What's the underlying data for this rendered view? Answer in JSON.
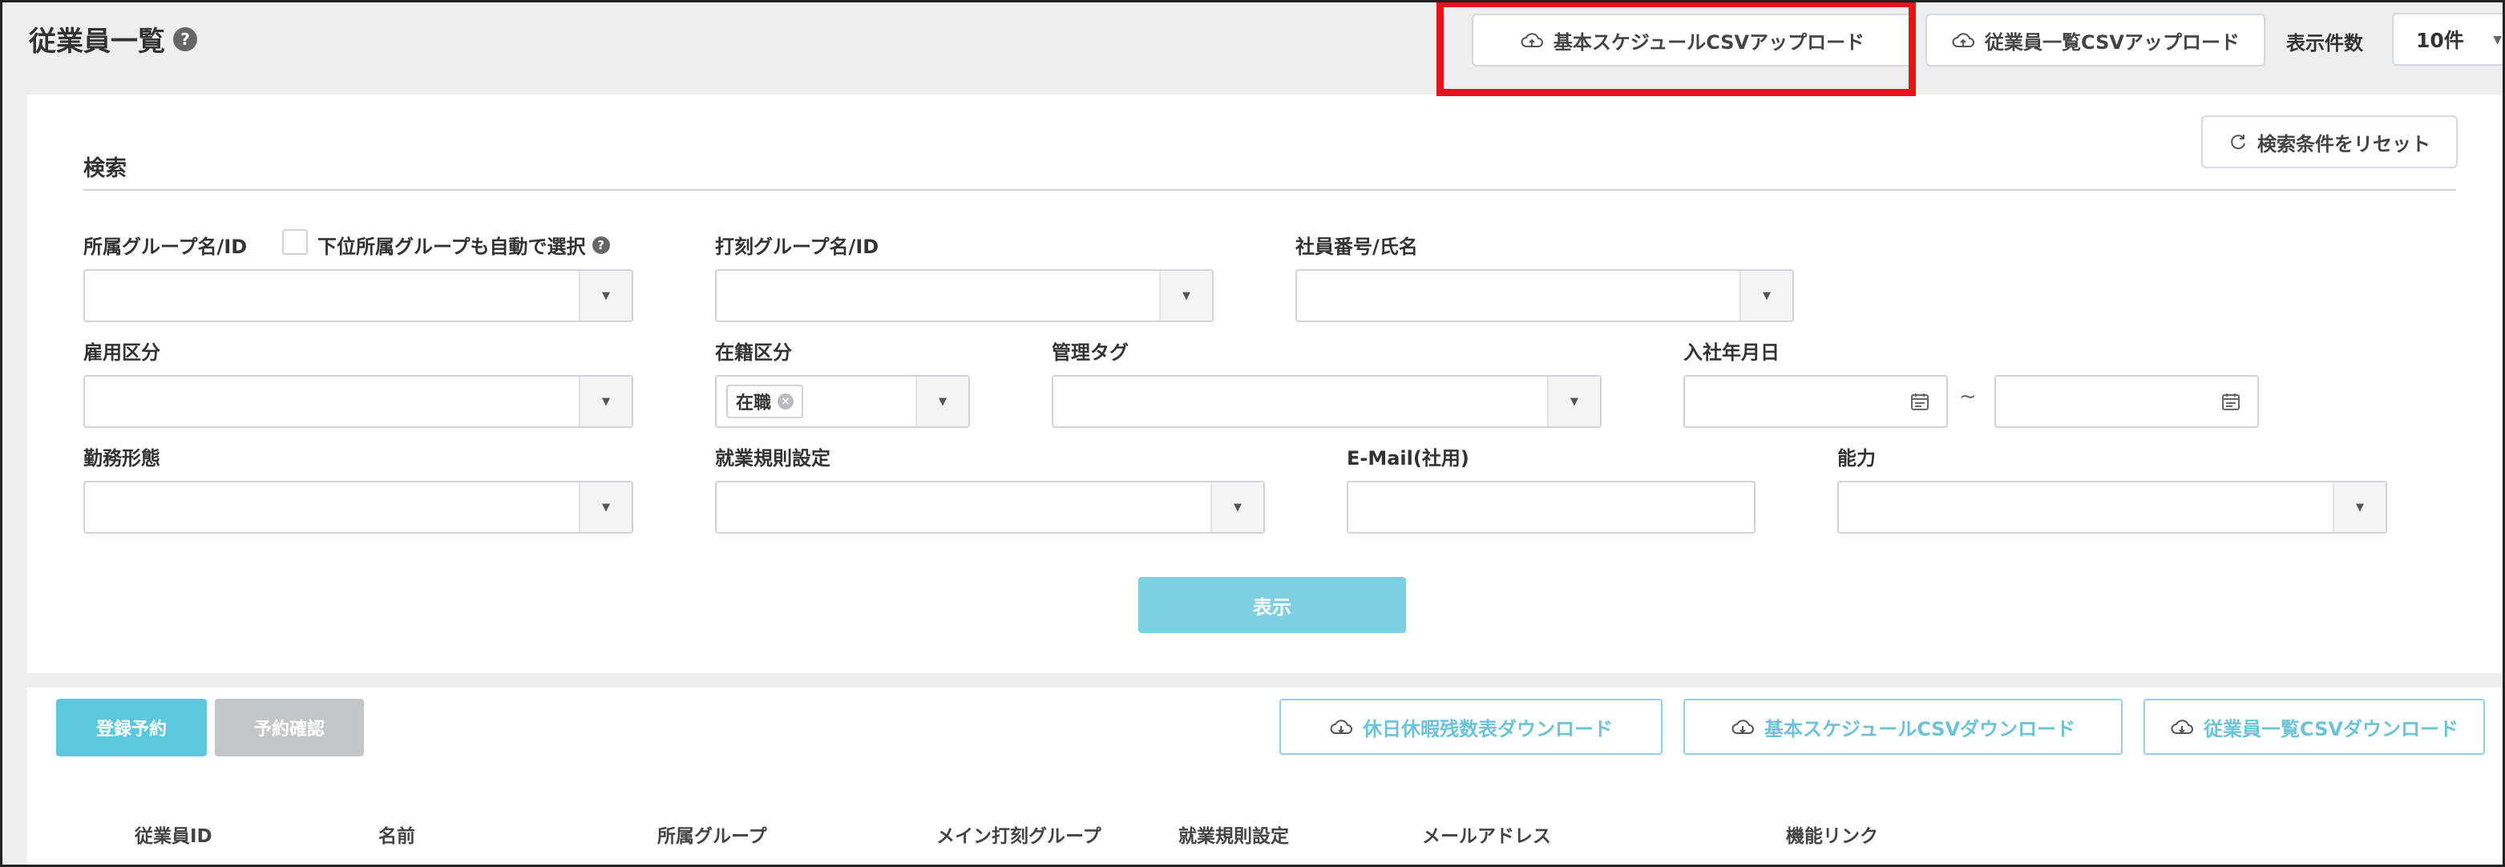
{
  "header": {
    "title": "従業員一覧",
    "help_icon": "?",
    "upload_schedule_csv": "基本スケジュールCSVアップロード",
    "upload_employee_csv": "従業員一覧CSVアップロード",
    "page_size_label": "表示件数",
    "page_size_value": "10件"
  },
  "search": {
    "title": "検索",
    "reset_label": "検索条件をリセット",
    "fields": {
      "group": "所属グループ名/ID",
      "auto_select_sub": "下位所属グループも自動で選択",
      "stamp_group": "打刻グループ名/ID",
      "employee_no": "社員番号/氏名",
      "employment_type": "雇用区分",
      "enrollment": "在籍区分",
      "enrollment_tag": "在職",
      "mgmt_tag": "管理タグ",
      "hire_date": "入社年月日",
      "date_sep": "~",
      "work_style": "勤務形態",
      "work_rules": "就業規則設定",
      "email": "E-Mail(社用)",
      "ability": "能力"
    },
    "show_label": "表示"
  },
  "list": {
    "reserve_label": "登録予約",
    "confirm_label": "予約確認",
    "dl_holiday": "休日休暇残数表ダウンロード",
    "dl_schedule": "基本スケジュールCSVダウンロード",
    "dl_employee": "従業員一覧CSVダウンロード",
    "columns": [
      "従業員ID",
      "名前",
      "所属グループ",
      "メイン打刻グループ",
      "就業規則設定",
      "メールアドレス",
      "機能リンク"
    ]
  },
  "colors": {
    "highlight": "#e8141a",
    "accent_cyan": "#5bc8dd",
    "disabled_gray": "#c4c7ca"
  }
}
